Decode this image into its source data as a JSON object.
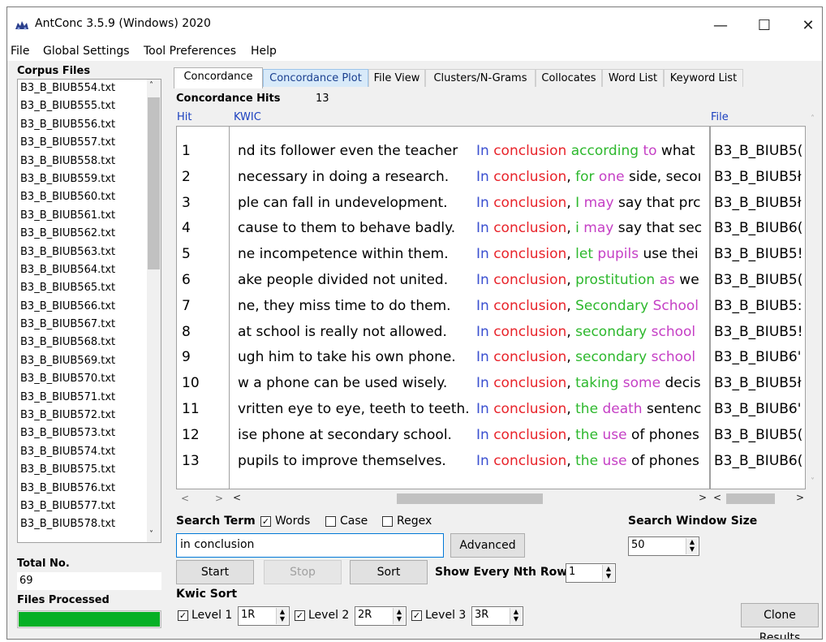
{
  "window": {
    "title": "AntConc 3.5.9 (Windows) 2020",
    "minimize": "—",
    "maximize": "☐",
    "close": "✕"
  },
  "menu": [
    "File",
    "Global Settings",
    "Tool Preferences",
    "Help"
  ],
  "left": {
    "corpus_label": "Corpus Files",
    "files": [
      "B3_B_BIUB554.txt",
      "B3_B_BIUB555.txt",
      "B3_B_BIUB556.txt",
      "B3_B_BIUB557.txt",
      "B3_B_BIUB558.txt",
      "B3_B_BIUB559.txt",
      "B3_B_BIUB560.txt",
      "B3_B_BIUB561.txt",
      "B3_B_BIUB562.txt",
      "B3_B_BIUB563.txt",
      "B3_B_BIUB564.txt",
      "B3_B_BIUB565.txt",
      "B3_B_BIUB566.txt",
      "B3_B_BIUB567.txt",
      "B3_B_BIUB568.txt",
      "B3_B_BIUB569.txt",
      "B3_B_BIUB570.txt",
      "B3_B_BIUB571.txt",
      "B3_B_BIUB572.txt",
      "B3_B_BIUB573.txt",
      "B3_B_BIUB574.txt",
      "B3_B_BIUB575.txt",
      "B3_B_BIUB576.txt",
      "B3_B_BIUB577.txt",
      "B3_B_BIUB578.txt"
    ],
    "total_label": "Total No.",
    "total_value": "69",
    "processed_label": "Files Processed",
    "progress": 1.0
  },
  "tabs": [
    {
      "label": "Concordance",
      "state": "active"
    },
    {
      "label": "Concordance Plot",
      "state": "hover"
    },
    {
      "label": "File View",
      "state": ""
    },
    {
      "label": "Clusters/N-Grams",
      "state": ""
    },
    {
      "label": "Collocates",
      "state": ""
    },
    {
      "label": "Word List",
      "state": ""
    },
    {
      "label": "Keyword List",
      "state": ""
    }
  ],
  "concordance": {
    "hits_label": "Concordance Hits",
    "hits_count": "13",
    "col_hit": "Hit",
    "col_kwic": "KWIC",
    "col_file": "File",
    "rows": [
      {
        "hit": "1",
        "left": "nd its follower even the teacher",
        "kwic": [
          [
            "In",
            "blue"
          ],
          [
            " ",
            ""
          ],
          [
            "conclusion",
            "red"
          ],
          [
            " ",
            ""
          ],
          [
            "according",
            "green"
          ],
          [
            " ",
            ""
          ],
          [
            "to",
            "magenta"
          ],
          [
            " what",
            ""
          ]
        ],
        "file": "B3_B_BIUB5("
      },
      {
        "hit": "2",
        "left": "necessary in doing a research.",
        "kwic": [
          [
            "In",
            "blue"
          ],
          [
            " ",
            ""
          ],
          [
            "conclusion",
            "red"
          ],
          [
            ", ",
            ""
          ],
          [
            "for",
            "green"
          ],
          [
            " ",
            ""
          ],
          [
            "one",
            "magenta"
          ],
          [
            " side, secoı",
            ""
          ]
        ],
        "file": "B3_B_BIUB5ł"
      },
      {
        "hit": "3",
        "left": "ple can fall in undevelopment.",
        "kwic": [
          [
            "In",
            "blue"
          ],
          [
            " ",
            ""
          ],
          [
            "conclusion",
            "red"
          ],
          [
            ", ",
            ""
          ],
          [
            "I",
            "green"
          ],
          [
            " ",
            ""
          ],
          [
            "may",
            "magenta"
          ],
          [
            " say that prc",
            ""
          ]
        ],
        "file": "B3_B_BIUB5ł"
      },
      {
        "hit": "4",
        "left": "cause to them to behave badly.",
        "kwic": [
          [
            "In",
            "blue"
          ],
          [
            " ",
            ""
          ],
          [
            "conclusion",
            "red"
          ],
          [
            ", ",
            ""
          ],
          [
            "i",
            "green"
          ],
          [
            " ",
            ""
          ],
          [
            "may",
            "magenta"
          ],
          [
            " say that sec",
            ""
          ]
        ],
        "file": "B3_B_BIUB6("
      },
      {
        "hit": "5",
        "left": "ne incompetence within them.",
        "kwic": [
          [
            "In",
            "blue"
          ],
          [
            " ",
            ""
          ],
          [
            "conclusion",
            "red"
          ],
          [
            ", ",
            ""
          ],
          [
            "let",
            "green"
          ],
          [
            " ",
            ""
          ],
          [
            "pupils",
            "magenta"
          ],
          [
            " use thei",
            ""
          ]
        ],
        "file": "B3_B_BIUB5!"
      },
      {
        "hit": "6",
        "left": "ake people divided not united.",
        "kwic": [
          [
            "In",
            "blue"
          ],
          [
            " ",
            ""
          ],
          [
            "conclusion",
            "red"
          ],
          [
            ", ",
            ""
          ],
          [
            "prostitution",
            "green"
          ],
          [
            " ",
            ""
          ],
          [
            "as",
            "magenta"
          ],
          [
            " we",
            ""
          ]
        ],
        "file": "B3_B_BIUB5("
      },
      {
        "hit": "7",
        "left": "ne, they miss time to do them.",
        "kwic": [
          [
            "In",
            "blue"
          ],
          [
            " ",
            ""
          ],
          [
            "conclusion",
            "red"
          ],
          [
            ", ",
            ""
          ],
          [
            "Secondary",
            "green"
          ],
          [
            " ",
            ""
          ],
          [
            "School",
            "magenta"
          ]
        ],
        "file": "B3_B_BIUB5:"
      },
      {
        "hit": "8",
        "left": "at school is really not allowed.",
        "kwic": [
          [
            "In",
            "blue"
          ],
          [
            " ",
            ""
          ],
          [
            "conclusion",
            "red"
          ],
          [
            ", ",
            ""
          ],
          [
            "secondary",
            "green"
          ],
          [
            " ",
            ""
          ],
          [
            "school",
            "magenta"
          ]
        ],
        "file": "B3_B_BIUB5!"
      },
      {
        "hit": "9",
        "left": "ugh him to take his own phone.",
        "kwic": [
          [
            "In",
            "blue"
          ],
          [
            " ",
            ""
          ],
          [
            "conclusion",
            "red"
          ],
          [
            ", ",
            ""
          ],
          [
            "secondary",
            "green"
          ],
          [
            " ",
            ""
          ],
          [
            "school",
            "magenta"
          ]
        ],
        "file": "B3_B_BIUB6'"
      },
      {
        "hit": "10",
        "left": "w a phone can be used wisely.",
        "kwic": [
          [
            "In",
            "blue"
          ],
          [
            " ",
            ""
          ],
          [
            "conclusion",
            "red"
          ],
          [
            ", ",
            ""
          ],
          [
            "taking",
            "green"
          ],
          [
            " ",
            ""
          ],
          [
            "some",
            "magenta"
          ],
          [
            " decis",
            ""
          ]
        ],
        "file": "B3_B_BIUB5ł"
      },
      {
        "hit": "11",
        "left": "vritten eye to eye, teeth to teeth.",
        "kwic": [
          [
            "In",
            "blue"
          ],
          [
            " ",
            ""
          ],
          [
            "conclusion",
            "red"
          ],
          [
            ", ",
            ""
          ],
          [
            "the",
            "green"
          ],
          [
            " ",
            ""
          ],
          [
            "death",
            "magenta"
          ],
          [
            " sentenc",
            ""
          ]
        ],
        "file": "B3_B_BIUB6'"
      },
      {
        "hit": "12",
        "left": "ise phone at secondary school.",
        "kwic": [
          [
            "In",
            "blue"
          ],
          [
            " ",
            ""
          ],
          [
            "conclusion",
            "red"
          ],
          [
            ", ",
            ""
          ],
          [
            "the",
            "green"
          ],
          [
            " ",
            ""
          ],
          [
            "use",
            "magenta"
          ],
          [
            " of phones",
            ""
          ]
        ],
        "file": "B3_B_BIUB5("
      },
      {
        "hit": "13",
        "left": "pupils to improve themselves.",
        "kwic": [
          [
            "In",
            "blue"
          ],
          [
            " ",
            ""
          ],
          [
            "conclusion",
            "red"
          ],
          [
            ", ",
            ""
          ],
          [
            "the",
            "green"
          ],
          [
            " ",
            ""
          ],
          [
            "use",
            "magenta"
          ],
          [
            " of phones",
            ""
          ]
        ],
        "file": "B3_B_BIUB6("
      }
    ]
  },
  "search": {
    "term_label": "Search Term",
    "words_label": "Words",
    "words_checked": true,
    "case_label": "Case",
    "case_checked": false,
    "regex_label": "Regex",
    "regex_checked": false,
    "value": "in conclusion",
    "advanced_label": "Advanced",
    "window_size_label": "Search Window Size",
    "window_size": "50"
  },
  "buttons": {
    "start": "Start",
    "stop": "Stop",
    "sort": "Sort",
    "nth_label": "Show Every Nth Row",
    "nth_value": "1",
    "clone": "Clone Results"
  },
  "kwic_sort": {
    "label": "Kwic Sort",
    "levels": [
      {
        "label": "Level 1",
        "value": "1R",
        "checked": true
      },
      {
        "label": "Level 2",
        "value": "2R",
        "checked": true
      },
      {
        "label": "Level 3",
        "value": "3R",
        "checked": true
      }
    ]
  },
  "colors": {
    "red": "#e8232a",
    "green": "#2db82d",
    "magenta": "#c53fc5",
    "blue": "#3a4fd0",
    "progress": "#06b025"
  }
}
